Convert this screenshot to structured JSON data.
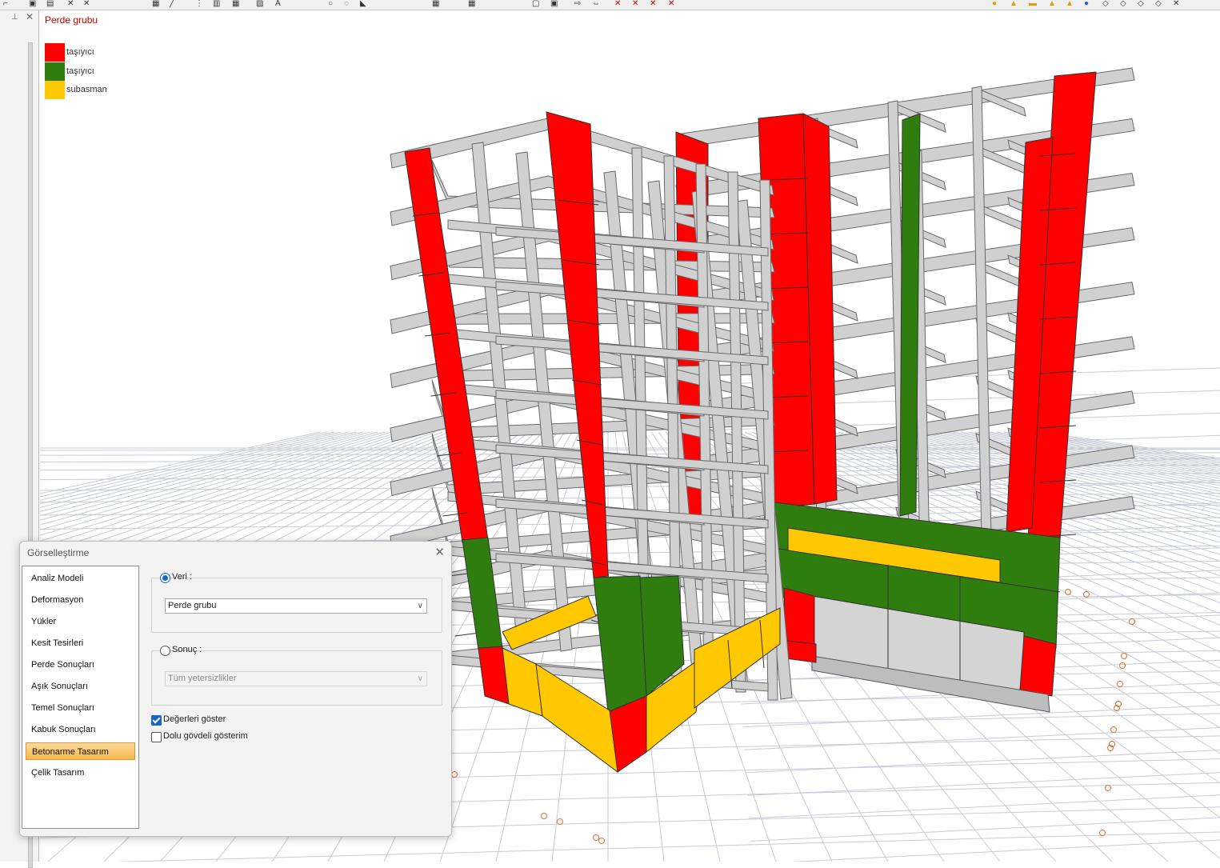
{
  "view": {
    "title": "Perde grubu",
    "legend": [
      {
        "label": "taşıyıcı",
        "color": "#ff0000"
      },
      {
        "label": "taşıyıcı",
        "color": "#2e7d0e"
      },
      {
        "label": "subasman",
        "color": "#ffc800"
      }
    ]
  },
  "colors": {
    "frame": "#d0d0d0",
    "frame_edge": "#6a6a6a",
    "grid": "#c8cbd6",
    "wall_red": "#ff0000",
    "wall_green": "#2e7d0e",
    "wall_yellow": "#ffc800",
    "accent": "#1a66c8"
  },
  "dialog": {
    "title": "Görselleştirme",
    "close_label": "✕",
    "nav": [
      {
        "label": "Analiz Modeli"
      },
      {
        "label": "Deformasyon"
      },
      {
        "label": "Yükler"
      },
      {
        "label": "Kesit Tesirleri"
      },
      {
        "label": "Perde Sonuçları"
      },
      {
        "label": "Aşık Sonuçları"
      },
      {
        "label": "Temel Sonuçları"
      },
      {
        "label": "Kabuk Sonuçları"
      },
      {
        "label": "Betonarme Tasarım",
        "selected": true
      },
      {
        "label": "Çelik Tasarım"
      }
    ],
    "veri": {
      "label": "Veri :",
      "selected": true,
      "value": "Perde grubu"
    },
    "sonuc": {
      "label": "Sonuç :",
      "selected": false,
      "value": "Tüm yetersizlikler"
    },
    "checkboxes": [
      {
        "label": "Değerleri göster",
        "checked": true
      },
      {
        "label": "Dolu gövdeli gösterim",
        "checked": false
      }
    ]
  }
}
